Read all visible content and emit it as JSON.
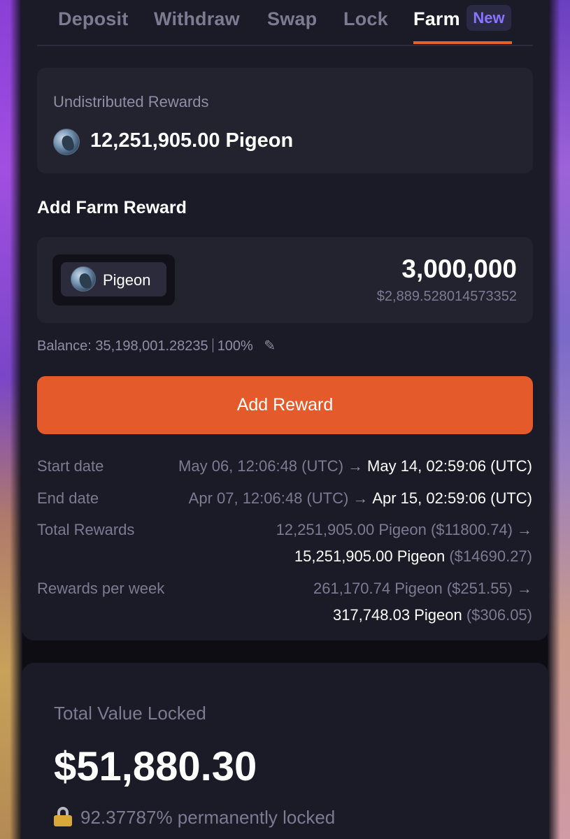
{
  "tabs": [
    "Deposit",
    "Withdraw",
    "Swap",
    "Lock",
    "Farm"
  ],
  "new_badge": "New",
  "undistributed": {
    "label": "Undistributed Rewards",
    "amount": "12,251,905.00 Pigeon"
  },
  "add_farm": {
    "title": "Add Farm Reward",
    "token": "Pigeon",
    "amount": "3,000,000",
    "amount_usd": "$2,889.528014573352",
    "balance_label": "Balance:",
    "balance_value": "35,198,001.28235",
    "percent": "100%",
    "button": "Add Reward"
  },
  "info": {
    "start_label": "Start date",
    "start_old": "May 06, 12:06:48 (UTC)",
    "start_new": "May 14, 02:59:06 (UTC)",
    "end_label": "End date",
    "end_old": "Apr 07, 12:06:48 (UTC)",
    "end_new": "Apr 15, 02:59:06 (UTC)",
    "total_label": "Total Rewards",
    "total_old": "12,251,905.00 Pigeon ($11800.74)",
    "total_new_amount": "15,251,905.00 Pigeon",
    "total_new_usd": "($14690.27)",
    "week_label": "Rewards per week",
    "week_old": "261,170.74 Pigeon ($251.55)",
    "week_new_amount": "317,748.03 Pigeon",
    "week_new_usd": "($306.05)",
    "arrow": "→"
  },
  "tvl": {
    "label": "Total Value Locked",
    "value": "$51,880.30",
    "locked_text": "92.37787% permanently locked"
  },
  "icons": {
    "token": "pigeon-token-icon",
    "edit": "pencil-icon",
    "lock": "lock-icon"
  },
  "colors": {
    "accent": "#e55a2a",
    "badge_text": "#8a73ff",
    "background": "#1b1a27"
  }
}
